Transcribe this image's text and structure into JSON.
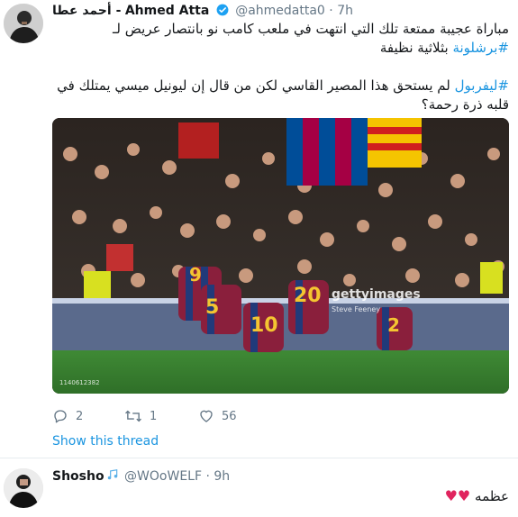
{
  "tweet1": {
    "name_latin": "Ahmed Atta",
    "name_arabic": "أحمد عطا -",
    "handle": "@ahmedatta0",
    "separator": "·",
    "time": "7h",
    "line1": "مباراة عجيبة ممتعة تلك التي انتهت في ملعب كامب نو بانتصار عريض لـ ",
    "line1_tag": "#برشلونة",
    "line1_end": " بثلاثية نظيفة",
    "line2_tag": "#ليفربول",
    "line2": " لم يستحق هذا المصير القاسي لكن من قال إن ليونيل ميسي يمتلك في قلبه ذرة رحمة؟",
    "media": {
      "watermark": "gettyimages",
      "credit": "Steve Feeney",
      "image_id": "1140612382",
      "jersey_numbers": [
        "9",
        "5",
        "10",
        "20",
        "2"
      ]
    },
    "actions": {
      "reply_count": "2",
      "retweet_count": "1",
      "like_count": "56"
    },
    "show_thread": "Show this thread"
  },
  "tweet2": {
    "name": "Shosho",
    "handle": "@WOoWELF",
    "separator": "·",
    "time": "9h",
    "text": "عظمه",
    "hearts": "♥♥"
  },
  "colors": {
    "link": "#1b95e0",
    "text": "#14171a",
    "muted": "#657786",
    "verified": "#1da1f2",
    "heart": "#e0245e",
    "note": "#5ab0e8"
  },
  "icons": {
    "verified": "verified-badge-icon",
    "reply": "reply-icon",
    "retweet": "retweet-icon",
    "like": "heart-icon",
    "music_note": "music-note-icon"
  }
}
